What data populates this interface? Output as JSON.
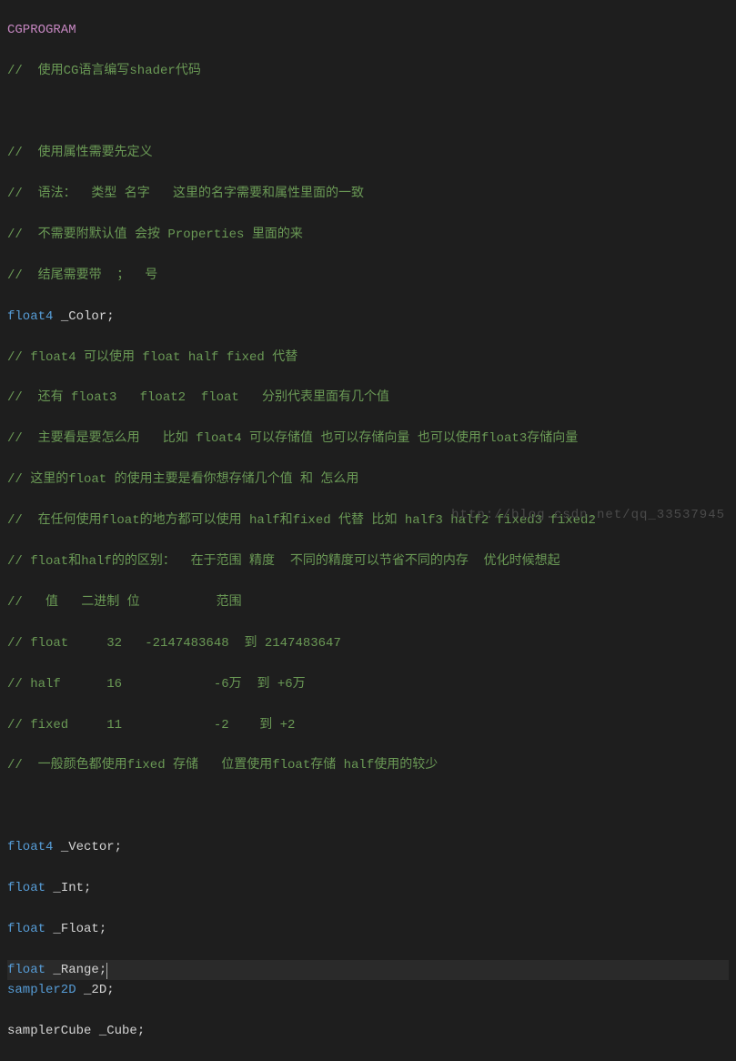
{
  "code": {
    "l1_macro": "CGPROGRAM",
    "l2": "//  使用CG语言编写shader代码",
    "l3": "",
    "l4": "//  使用属性需要先定义",
    "l5": "//  语法：  类型 名字   这里的名字需要和属性里面的一致",
    "l6": "//  不需要附默认值 会按 Properties 里面的来",
    "l7": "//  结尾需要带  ；  号",
    "l8_type": "float4",
    "l8_name": " _Color",
    "l8_end": ";",
    "l9": "// float4 可以使用 float half fixed 代替",
    "l10": "//  还有 float3   float2  float   分别代表里面有几个值",
    "l11": "//  主要看是要怎么用   比如 float4 可以存储值 也可以存储向量 也可以使用float3存储向量",
    "l12": "// 这里的float 的使用主要是看你想存储几个值 和 怎么用",
    "l13": "//  在任何使用float的地方都可以使用 half和fixed 代替 比如 half3 half2 fixed3 fixed2",
    "l14": "// float和half的的区别：  在于范围 精度  不同的精度可以节省不同的内存  优化时候想起",
    "l15": "//   值   二进制 位          范围",
    "l16": "// float     32   -2147483648  到 2147483647",
    "l17": "// half      16            -6万  到 +6万",
    "l18": "// fixed     11            -2    到 +2",
    "l19": "//  一般颜色都使用fixed 存储   位置使用float存储 half使用的较少",
    "l20": "",
    "l21_type": "float4",
    "l21_name": " _Vector",
    "l21_end": ";",
    "l22_type": "float",
    "l22_name": " _Int",
    "l22_end": ";",
    "l23_type": "float",
    "l23_name": " _Float",
    "l23_end": ";",
    "l24_type": "float",
    "l24_name": " _Range",
    "l24_end": ";",
    "l25_type": "sampler2D",
    "l25_name": " _2D",
    "l25_end": ";",
    "l26_type": "samplerCube",
    "l26_name": " _Cube",
    "l26_end": ";"
  },
  "watermark": "http://blog.csdn.net/qq_33537945"
}
